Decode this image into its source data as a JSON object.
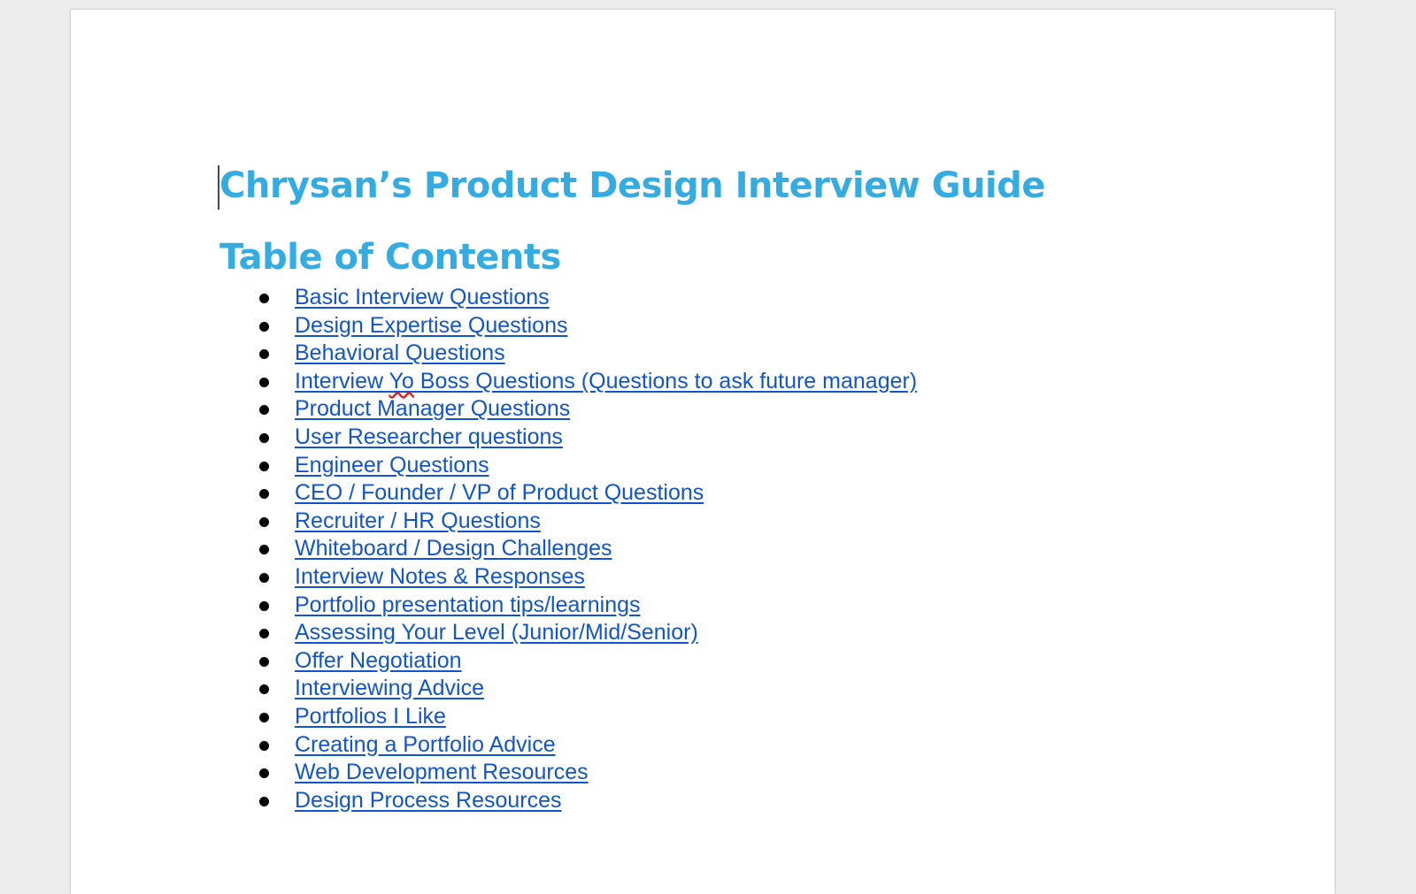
{
  "document": {
    "title": "Chrysan’s Product Design Interview Guide",
    "toc_heading": "Table of Contents",
    "toc_items": [
      "Basic Interview Questions",
      "Design Expertise Questions",
      "Behavioral Questions",
      "Interview Yo Boss Questions (Questions to ask future manager)",
      "Product Manager Questions",
      "User Researcher questions",
      "Engineer Questions",
      "CEO / Founder / VP of Product Questions",
      "Recruiter / HR Questions",
      "Whiteboard / Design Challenges",
      "Interview Notes & Responses",
      "Portfolio presentation tips/learnings",
      "Assessing Your Level (Junior/Mid/Senior)",
      "Offer Negotiation",
      "Interviewing Advice",
      "Portfolios I Like",
      "Creating a Portfolio Advice",
      "Web Development Resources",
      "Design Process Resources"
    ]
  },
  "colors": {
    "heading": "#34ace2",
    "link": "#1155cc",
    "spellcheck": "#e02020"
  },
  "icons": {
    "list_bullet": "bullet-dot-icon"
  }
}
